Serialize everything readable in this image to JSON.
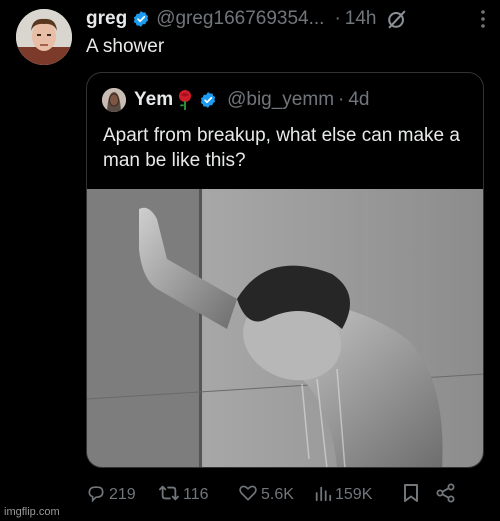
{
  "tweet": {
    "author_name": "greg",
    "author_handle": "@greg166769354...",
    "time": "14h",
    "text": "A shower"
  },
  "quote": {
    "author_name": "Yem",
    "author_handle": "@big_yemm",
    "time": "4d",
    "text": "Apart from breakup, what else can make a man be like this?"
  },
  "actions": {
    "replies": "219",
    "reposts": "116",
    "likes": "5.6K",
    "views": "159K"
  },
  "watermark": "imgflip.com",
  "colors": {
    "background": "#000000",
    "text": "#e7e9ea",
    "muted": "#71767b",
    "verified": "#1d9bf0",
    "border": "#2f3336"
  },
  "icons": [
    "verified-badge-icon",
    "grok-icon",
    "more-icon",
    "rose-emoji-icon",
    "reply-icon",
    "repost-icon",
    "like-icon",
    "views-icon",
    "bookmark-icon",
    "share-icon"
  ]
}
